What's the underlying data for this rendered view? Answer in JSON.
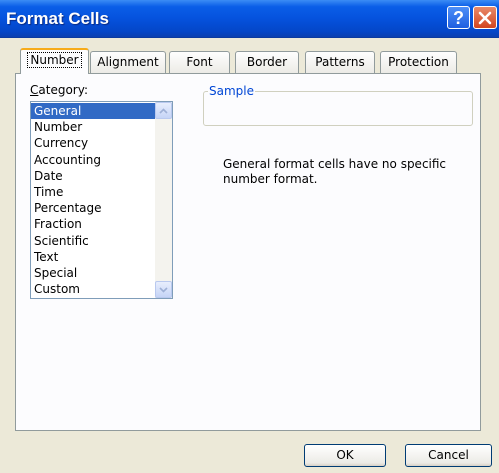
{
  "window": {
    "title": "Format Cells",
    "help_glyph": "?"
  },
  "tabs": [
    {
      "label": "Number",
      "active": true
    },
    {
      "label": "Alignment",
      "active": false
    },
    {
      "label": "Font",
      "active": false
    },
    {
      "label": "Border",
      "active": false
    },
    {
      "label": "Patterns",
      "active": false
    },
    {
      "label": "Protection",
      "active": false
    }
  ],
  "category": {
    "label_prefix": "C",
    "label_rest": "ategory:",
    "selected": "General",
    "items": [
      "General",
      "Number",
      "Currency",
      "Accounting",
      "Date",
      "Time",
      "Percentage",
      "Fraction",
      "Scientific",
      "Text",
      "Special",
      "Custom"
    ]
  },
  "sample": {
    "legend": "Sample",
    "value": ""
  },
  "description": "General format cells have no specific number format.",
  "buttons": {
    "ok": "OK",
    "cancel": "Cancel"
  },
  "colors": {
    "title_bar": "#0552dd",
    "selection": "#316ac5",
    "tab_highlight": "#f7ab1a",
    "dialog_bg": "#ece9d8"
  }
}
